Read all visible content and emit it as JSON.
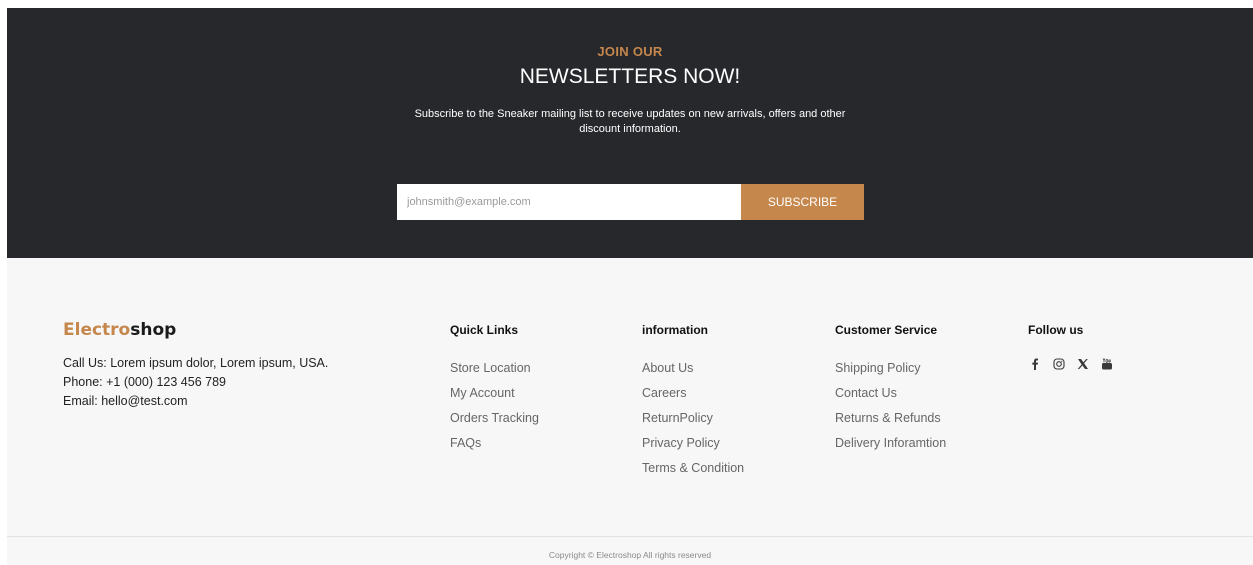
{
  "newsletter": {
    "kicker": "JOIN OUR",
    "title": "NEWSLETTERS NOW!",
    "description": "Subscribe to the Sneaker mailing list to receive updates on new arrivals, offers and other discount information.",
    "email_placeholder": "johnsmith@example.com",
    "subscribe_label": "SUBSCRIBE"
  },
  "brand": {
    "part1": "Electro",
    "part2": "shop"
  },
  "contact": {
    "call": "Call Us: Lorem ipsum dolor, Lorem ipsum, USA.",
    "phone": "Phone: +1 (000) 123 456 789",
    "email": "Email: hello@test.com"
  },
  "quick_links": {
    "title": "Quick Links",
    "items": [
      "Store Location",
      "My Account",
      "Orders Tracking",
      "FAQs"
    ]
  },
  "information": {
    "title": "information",
    "items": [
      "About Us",
      "Careers",
      "ReturnPolicy",
      "Privacy Policy",
      "Terms & Condition"
    ]
  },
  "customer_service": {
    "title": "Customer Service",
    "items": [
      "Shipping Policy",
      "Contact Us",
      "Returns & Refunds",
      "Delivery Inforamtion"
    ]
  },
  "follow": {
    "title": "Follow us",
    "icons": [
      "facebook-icon",
      "instagram-icon",
      "x-icon",
      "youtube-icon"
    ]
  },
  "copyright": "Copyright © Electroshop All rights reserved",
  "colors": {
    "accent": "#c6874d",
    "dark": "#26282b",
    "footer_bg": "#f7f7f7"
  }
}
